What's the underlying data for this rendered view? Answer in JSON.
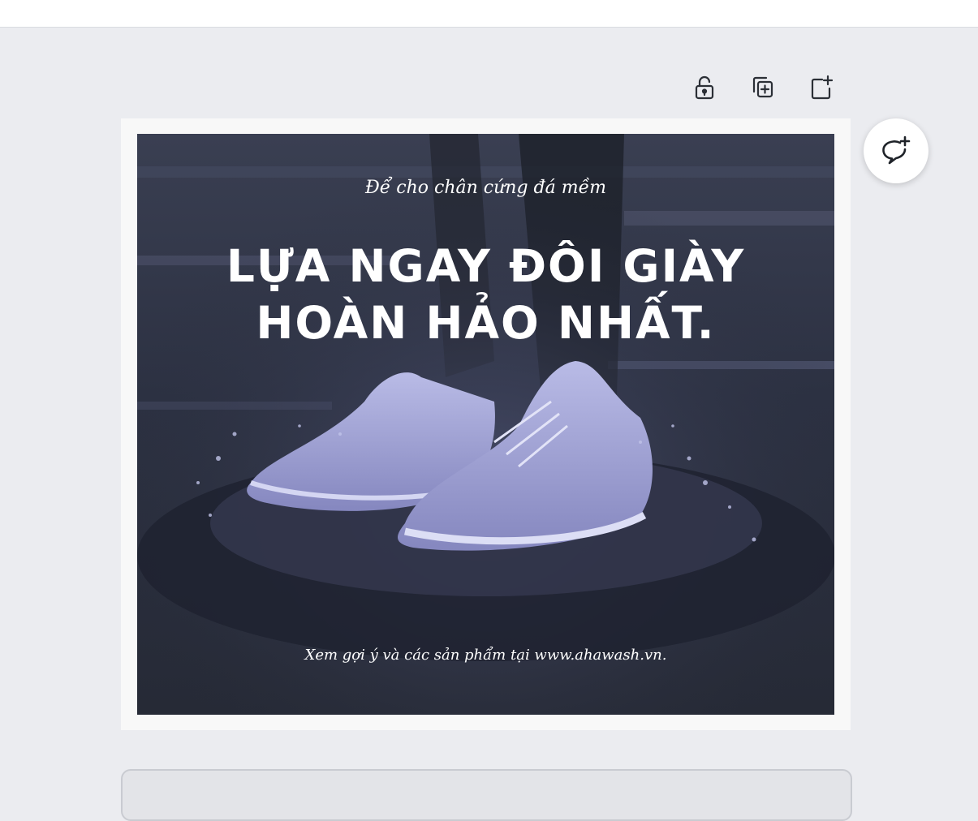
{
  "toolbar": {
    "lock_icon": "unlock-icon",
    "duplicate_icon": "duplicate-page-icon",
    "add_icon": "add-page-icon"
  },
  "comment": {
    "icon": "add-comment-icon"
  },
  "design": {
    "subtitle": "Để cho chân cứng đá mềm",
    "headline_line1": "LỰA NGAY ĐÔI GIÀY",
    "headline_line2": "HOÀN HẢO NHẤT.",
    "footer": "Xem gợi ý và các sản phẩm tại www.ahawash.vn.",
    "image": "white-sneakers-splashing-water-photo"
  },
  "colors": {
    "canvas_bg": "#ebecf0",
    "design_text": "#ffffff",
    "design_bg": "#33384a"
  }
}
